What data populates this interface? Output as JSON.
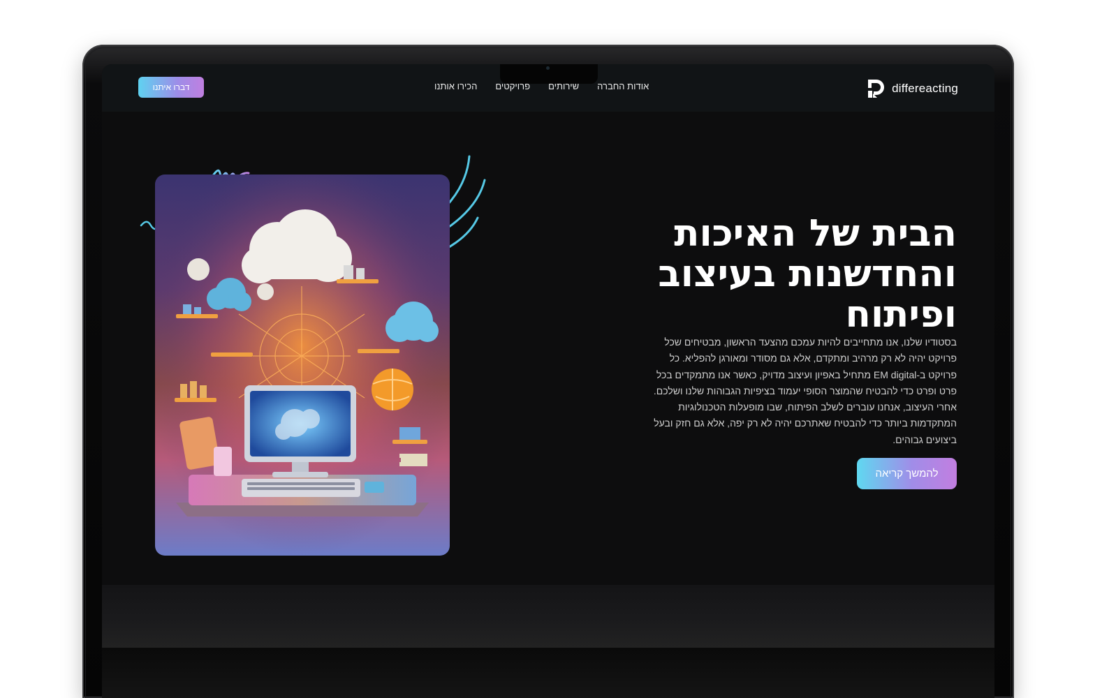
{
  "brand": {
    "name": "differeacting"
  },
  "nav": {
    "items": [
      {
        "label": "אודות החברה"
      },
      {
        "label": "שירותים"
      },
      {
        "label": "פרויקטים"
      },
      {
        "label": "הכירו אותנו"
      }
    ],
    "cta_label": "דברו איתנו"
  },
  "hero": {
    "title": "הבית של האיכות והחדשנות בעיצוב ופיתוח",
    "body": "בסטודיו שלנו, אנו מתחייבים להיות עמכם מהצעד הראשון, מבטיחים שכל פרויקט יהיה לא רק מרהיב ומתקדם, אלא גם מסודר ומאורגן להפליא. כל פרויקט ב-EM digital מתחיל באפיון ועיצוב מדויק, כאשר אנו מתמקדים בכל פרט ופרט כדי להבטיח שהמוצר הסופי יעמוד בציפיות הגבוהות שלנו ושלכם. אחרי העיצוב, אנחנו עוברים לשלב הפיתוח, שבו מופעלות הטכנולוגיות המתקדמות ביותר כדי להבטיח שאתרכם יהיה לא רק יפה, אלא גם חזק ובעל ביצועים גבוהים.",
    "cta_label": "להמשך קריאה"
  },
  "colors": {
    "accent_start": "#5fd8f0",
    "accent_end": "#c27ee0",
    "background": "#0d0d0e",
    "header": "#111416"
  }
}
